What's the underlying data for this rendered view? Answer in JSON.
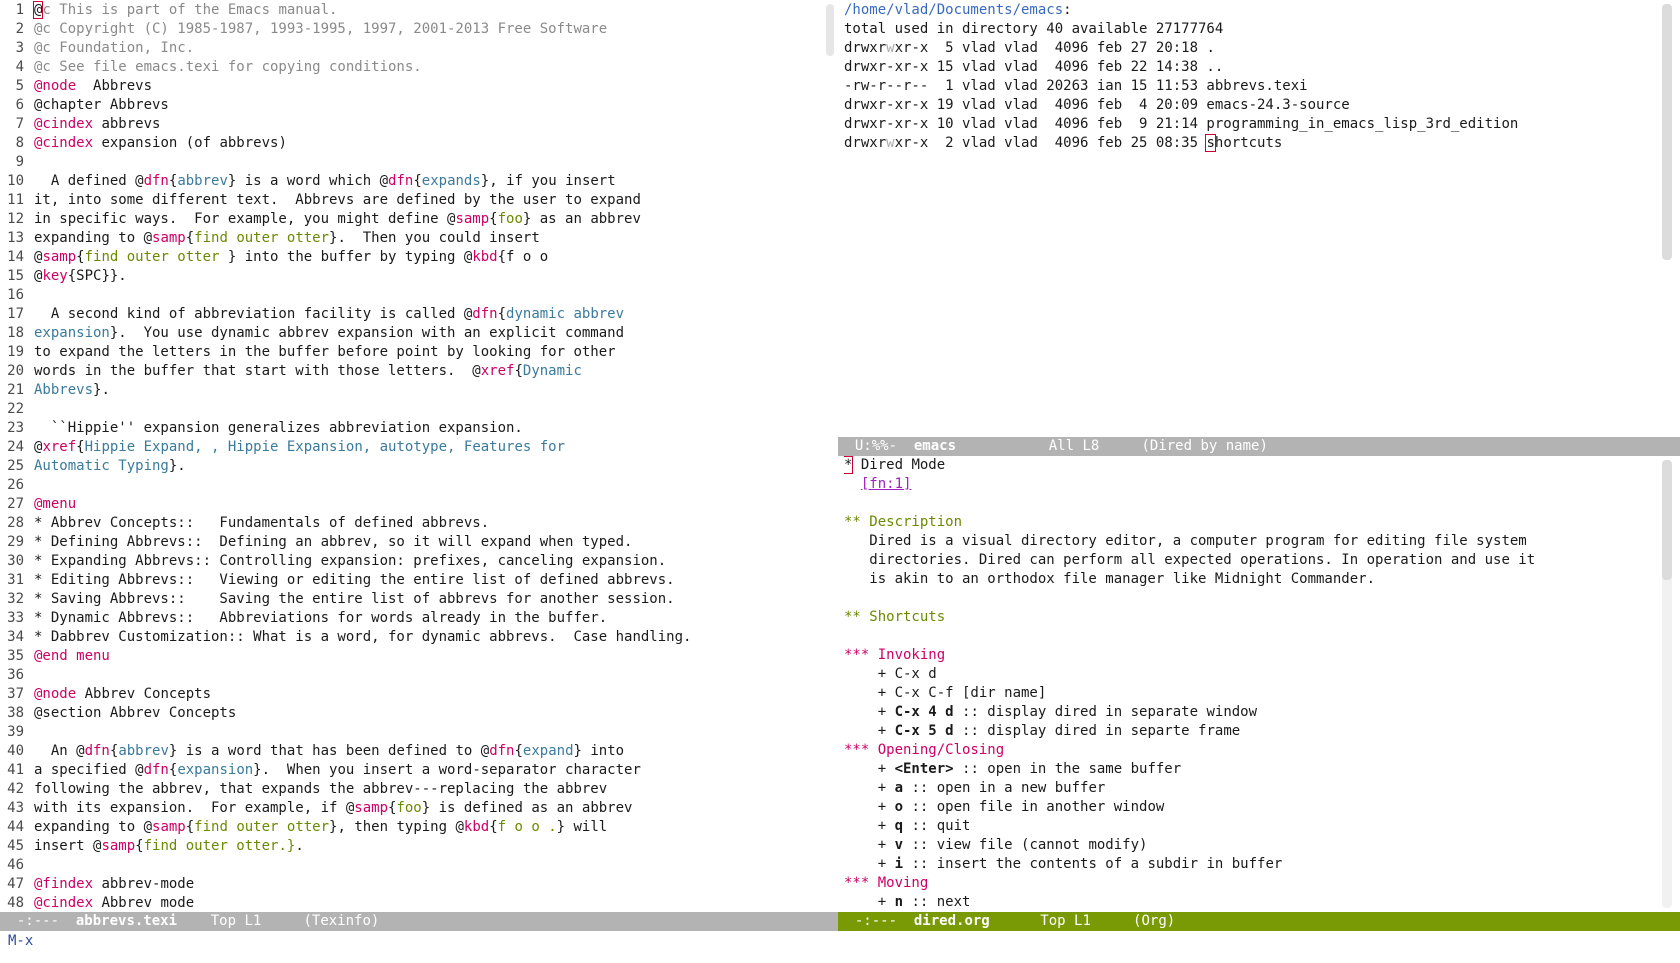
{
  "left": {
    "lines": [
      {
        "n": "1",
        "segs": [
          [
            "cursor",
            "@"
          ],
          [
            "comment",
            "c This is part of the Emacs manual."
          ]
        ]
      },
      {
        "n": "2",
        "segs": [
          [
            "comment",
            "@c Copyright (C) 1985-1987, 1993-1995, 1997, 2001-2013 Free Software"
          ]
        ]
      },
      {
        "n": "3",
        "segs": [
          [
            "comment",
            "@c Foundation, Inc."
          ]
        ]
      },
      {
        "n": "4",
        "segs": [
          [
            "comment",
            "@c See file emacs.texi for copying conditions."
          ]
        ]
      },
      {
        "n": "5",
        "segs": [
          [
            "kw",
            "@node"
          ],
          [
            "",
            "  Abbrevs"
          ]
        ]
      },
      {
        "n": "6",
        "segs": [
          [
            "",
            "@chapter Abbrevs"
          ]
        ]
      },
      {
        "n": "7",
        "segs": [
          [
            "kw",
            "@cindex"
          ],
          [
            "",
            " abbrevs"
          ]
        ]
      },
      {
        "n": "8",
        "segs": [
          [
            "kw",
            "@cindex"
          ],
          [
            "",
            " expansion (of abbrevs)"
          ]
        ]
      },
      {
        "n": "9",
        "segs": []
      },
      {
        "n": "10",
        "segs": [
          [
            "",
            "  A defined @"
          ],
          [
            "kw",
            "dfn"
          ],
          [
            "",
            "{"
          ],
          [
            "arg",
            "abbrev"
          ],
          [
            "",
            "} is a word which @"
          ],
          [
            "kw",
            "dfn"
          ],
          [
            "",
            "{"
          ],
          [
            "arg",
            "expands"
          ],
          [
            "",
            "}, if you insert"
          ]
        ]
      },
      {
        "n": "11",
        "segs": [
          [
            "",
            "it, into some different text.  Abbrevs are defined by the user to expand"
          ]
        ]
      },
      {
        "n": "12",
        "segs": [
          [
            "",
            "in specific ways.  For example, you might define @"
          ],
          [
            "kw",
            "samp"
          ],
          [
            "",
            "{"
          ],
          [
            "samp",
            "foo"
          ],
          [
            "",
            "} as an abbrev"
          ]
        ]
      },
      {
        "n": "13",
        "segs": [
          [
            "",
            "expanding to @"
          ],
          [
            "kw",
            "samp"
          ],
          [
            "",
            "{"
          ],
          [
            "samp",
            "find outer otter"
          ],
          [
            "",
            "}.  Then you could insert"
          ]
        ]
      },
      {
        "n": "14",
        "segs": [
          [
            "",
            "@"
          ],
          [
            "kw",
            "samp"
          ],
          [
            "",
            "{"
          ],
          [
            "samp",
            "find outer otter "
          ],
          [
            "",
            "} into the buffer by typing @"
          ],
          [
            "kw",
            "kbd"
          ],
          [
            "",
            "{f o o"
          ]
        ]
      },
      {
        "n": "15",
        "segs": [
          [
            "",
            "@"
          ],
          [
            "kw",
            "key"
          ],
          [
            "",
            "{SPC}}."
          ]
        ]
      },
      {
        "n": "16",
        "segs": []
      },
      {
        "n": "17",
        "segs": [
          [
            "",
            "  A second kind of abbreviation facility is called @"
          ],
          [
            "kw",
            "dfn"
          ],
          [
            "",
            "{"
          ],
          [
            "arg",
            "dynamic abbrev"
          ]
        ]
      },
      {
        "n": "18",
        "segs": [
          [
            "arg",
            "expansion"
          ],
          [
            "",
            "}.  You use dynamic abbrev expansion with an explicit command"
          ]
        ]
      },
      {
        "n": "19",
        "segs": [
          [
            "",
            "to expand the letters in the buffer before point by looking for other"
          ]
        ]
      },
      {
        "n": "20",
        "segs": [
          [
            "",
            "words in the buffer that start with those letters.  @"
          ],
          [
            "kw",
            "xref"
          ],
          [
            "",
            "{"
          ],
          [
            "arg",
            "Dynamic"
          ]
        ]
      },
      {
        "n": "21",
        "segs": [
          [
            "arg",
            "Abbrevs"
          ],
          [
            "",
            "}."
          ]
        ]
      },
      {
        "n": "22",
        "segs": []
      },
      {
        "n": "23",
        "segs": [
          [
            "",
            "  ``Hippie'' expansion generalizes abbreviation expansion."
          ]
        ]
      },
      {
        "n": "24",
        "segs": [
          [
            "",
            "@"
          ],
          [
            "kw",
            "xref"
          ],
          [
            "",
            "{"
          ],
          [
            "arg",
            "Hippie Expand, , Hippie Expansion, autotype, Features for"
          ]
        ]
      },
      {
        "n": "25",
        "segs": [
          [
            "arg",
            "Automatic Typing"
          ],
          [
            "",
            "}."
          ]
        ]
      },
      {
        "n": "26",
        "segs": []
      },
      {
        "n": "27",
        "segs": [
          [
            "kw",
            "@menu"
          ]
        ]
      },
      {
        "n": "28",
        "segs": [
          [
            "",
            "* Abbrev Concepts::   Fundamentals of defined abbrevs."
          ]
        ]
      },
      {
        "n": "29",
        "segs": [
          [
            "",
            "* Defining Abbrevs::  Defining an abbrev, so it will expand when typed."
          ]
        ]
      },
      {
        "n": "30",
        "segs": [
          [
            "",
            "* Expanding Abbrevs:: Controlling expansion: prefixes, canceling expansion."
          ]
        ]
      },
      {
        "n": "31",
        "segs": [
          [
            "",
            "* Editing Abbrevs::   Viewing or editing the entire list of defined abbrevs."
          ]
        ]
      },
      {
        "n": "32",
        "segs": [
          [
            "",
            "* Saving Abbrevs::    Saving the entire list of abbrevs for another session."
          ]
        ]
      },
      {
        "n": "33",
        "segs": [
          [
            "",
            "* Dynamic Abbrevs::   Abbreviations for words already in the buffer."
          ]
        ]
      },
      {
        "n": "34",
        "segs": [
          [
            "",
            "* Dabbrev Customization:: What is a word, for dynamic abbrevs.  Case handling."
          ]
        ]
      },
      {
        "n": "35",
        "segs": [
          [
            "kw",
            "@end menu"
          ]
        ]
      },
      {
        "n": "36",
        "segs": []
      },
      {
        "n": "37",
        "segs": [
          [
            "kw",
            "@node"
          ],
          [
            "",
            " Abbrev Concepts"
          ]
        ]
      },
      {
        "n": "38",
        "segs": [
          [
            "",
            "@section Abbrev Concepts"
          ]
        ]
      },
      {
        "n": "39",
        "segs": []
      },
      {
        "n": "40",
        "segs": [
          [
            "",
            "  An @"
          ],
          [
            "kw",
            "dfn"
          ],
          [
            "",
            "{"
          ],
          [
            "arg",
            "abbrev"
          ],
          [
            "",
            "} is a word that has been defined to @"
          ],
          [
            "kw",
            "dfn"
          ],
          [
            "",
            "{"
          ],
          [
            "arg",
            "expand"
          ],
          [
            "",
            "} into"
          ]
        ]
      },
      {
        "n": "41",
        "segs": [
          [
            "",
            "a specified @"
          ],
          [
            "kw",
            "dfn"
          ],
          [
            "",
            "{"
          ],
          [
            "arg",
            "expansion"
          ],
          [
            "",
            "}.  When you insert a word-separator character"
          ]
        ]
      },
      {
        "n": "42",
        "segs": [
          [
            "",
            "following the abbrev, that expands the abbrev---replacing the abbrev"
          ]
        ]
      },
      {
        "n": "43",
        "segs": [
          [
            "",
            "with its expansion.  For example, if @"
          ],
          [
            "kw",
            "samp"
          ],
          [
            "",
            "{"
          ],
          [
            "samp",
            "foo"
          ],
          [
            "",
            "} is defined as an abbrev"
          ]
        ]
      },
      {
        "n": "44",
        "segs": [
          [
            "",
            "expanding to @"
          ],
          [
            "kw",
            "samp"
          ],
          [
            "",
            "{"
          ],
          [
            "samp",
            "find outer otter"
          ],
          [
            "",
            "}, then typing @"
          ],
          [
            "kw",
            "kbd"
          ],
          [
            "",
            "{"
          ],
          [
            "samp",
            "f o o ."
          ],
          [
            "",
            "} will"
          ]
        ]
      },
      {
        "n": "45",
        "segs": [
          [
            "",
            "insert @"
          ],
          [
            "kw",
            "samp"
          ],
          [
            "",
            "{"
          ],
          [
            "samp",
            "find outer otter.}"
          ],
          [
            "",
            "."
          ]
        ]
      },
      {
        "n": "46",
        "segs": []
      },
      {
        "n": "47",
        "segs": [
          [
            "kw",
            "@findex"
          ],
          [
            "",
            " abbrev-mode"
          ]
        ]
      },
      {
        "n": "48",
        "segs": [
          [
            "kw",
            "@cindex"
          ],
          [
            "",
            " Abbrev mode"
          ]
        ]
      }
    ],
    "modeline": {
      "flags": "-:---  ",
      "buffer": "abbrevs.texi",
      "pos": "    Top L1     ",
      "mode": "(Texinfo)"
    }
  },
  "right_top": {
    "lines": [
      [
        [
          "dir",
          "/home/vlad/Documents/emacs"
        ],
        [
          "",
          ":"
        ]
      ],
      [
        [
          "",
          "total used in directory 40 available 27177764"
        ]
      ],
      [
        [
          "",
          "drwxr"
        ],
        [
          "dim",
          "w"
        ],
        [
          "",
          "xr-x  5 vlad vlad  4096 feb 27 20:18 ."
        ]
      ],
      [
        [
          "",
          "drwxr-xr-x 15 vlad vlad  4096 feb 22 14:38 .."
        ]
      ],
      [
        [
          "",
          "-rw-r--r--  1 vlad vlad 20263 ian 15 11:53 abbrevs.texi"
        ]
      ],
      [
        [
          "",
          "drwxr-xr-x 19 vlad vlad  4096 feb  4 20:09 emacs-24.3-source"
        ]
      ],
      [
        [
          "",
          "drwxr-xr-x 10 vlad vlad  4096 feb  9 21:14 programming_in_emacs_lisp_3rd_edition"
        ]
      ],
      [
        [
          "",
          "drwxr"
        ],
        [
          "dim",
          "w"
        ],
        [
          "",
          "xr-x  2 vlad vlad  4096 feb 25 08:35 "
        ],
        [
          "cursor",
          "s"
        ],
        [
          "",
          "hortcuts"
        ]
      ]
    ],
    "modeline": {
      "flags": "U:%%-  ",
      "buffer": "emacs",
      "pos": "           All L8     ",
      "mode": "(Dired by name)"
    }
  },
  "right_bottom": {
    "lines": [
      [
        [
          "cursor",
          "*"
        ],
        [
          "",
          " Dired Mode"
        ]
      ],
      [
        [
          "",
          "  "
        ],
        [
          "link",
          "[fn:1]"
        ]
      ],
      [],
      [
        [
          "h2",
          "** Description"
        ]
      ],
      [
        [
          "",
          "   Dired is a visual directory editor, a computer program for editing file system"
        ]
      ],
      [
        [
          "",
          "   directories. Dired can perform all expected operations. In operation and use it"
        ]
      ],
      [
        [
          "",
          "   is akin to an orthodox file manager like Midnight Commander."
        ]
      ],
      [],
      [
        [
          "h2",
          "** Shortcuts"
        ]
      ],
      [],
      [
        [
          "h3",
          "*** Invoking"
        ]
      ],
      [
        [
          "",
          "    + C-x d"
        ]
      ],
      [
        [
          "",
          "    + C-x C-f [dir name]"
        ]
      ],
      [
        [
          "",
          "    + "
        ],
        [
          "bold",
          "C-x 4 d"
        ],
        [
          "",
          " :: display dired in separate window"
        ]
      ],
      [
        [
          "",
          "    + "
        ],
        [
          "bold",
          "C-x 5 d"
        ],
        [
          "",
          " :: display dired in separte frame"
        ]
      ],
      [
        [
          "h3",
          "*** Opening/Closing"
        ]
      ],
      [
        [
          "",
          "    + "
        ],
        [
          "bold",
          "<Enter>"
        ],
        [
          "",
          " :: open in the same buffer"
        ]
      ],
      [
        [
          "",
          "    + "
        ],
        [
          "bold",
          "a"
        ],
        [
          "",
          " :: open in a new buffer"
        ]
      ],
      [
        [
          "",
          "    + "
        ],
        [
          "bold",
          "o"
        ],
        [
          "",
          " :: open file in another window"
        ]
      ],
      [
        [
          "",
          "    + "
        ],
        [
          "bold",
          "q"
        ],
        [
          "",
          " :: quit"
        ]
      ],
      [
        [
          "",
          "    + "
        ],
        [
          "bold",
          "v"
        ],
        [
          "",
          " :: view file (cannot modify)"
        ]
      ],
      [
        [
          "",
          "    + "
        ],
        [
          "bold",
          "i"
        ],
        [
          "",
          " :: insert the contents of a subdir in buffer"
        ]
      ],
      [
        [
          "h3",
          "*** Moving"
        ]
      ],
      [
        [
          "",
          "    + "
        ],
        [
          "bold",
          "n"
        ],
        [
          "",
          " :: next"
        ]
      ]
    ],
    "modeline": {
      "flags": "-:---  ",
      "buffer": "dired.org",
      "pos": "      Top L1     ",
      "mode": "(Org)"
    }
  },
  "minibuffer": {
    "text": "M-x"
  }
}
